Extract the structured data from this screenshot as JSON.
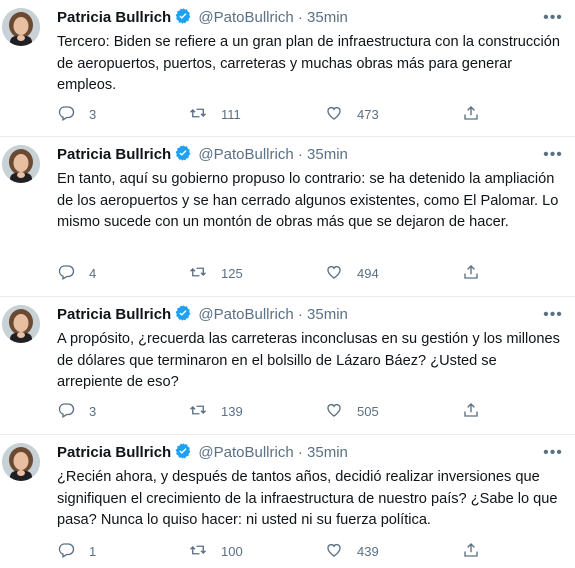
{
  "tweets": [
    {
      "name": "Patricia Bullrich",
      "handle": "@PatoBullrich",
      "separator": "·",
      "time": "35min",
      "text": "Tercero: Biden se refiere a un gran plan de infraestructura con la construcción de aeropuertos, puertos,  carreteras y muchas obras más para generar empleos.",
      "replies": "3",
      "retweets": "111",
      "likes": "473"
    },
    {
      "name": "Patricia Bullrich",
      "handle": "@PatoBullrich",
      "separator": "·",
      "time": "35min",
      "text": "En tanto, aquí su gobierno propuso lo contrario: se ha detenido la ampliación de los aeropuertos y se han cerrado algunos existentes, como El Palomar. Lo mismo sucede con un montón de obras más que se dejaron de hacer.",
      "replies": "4",
      "retweets": "125",
      "likes": "494"
    },
    {
      "name": "Patricia Bullrich",
      "handle": "@PatoBullrich",
      "separator": "·",
      "time": "35min",
      "text": "A propósito,  ¿recuerda las carreteras inconclusas en su gestión y los millones de dólares que terminaron en el bolsillo de Lázaro Báez? ¿Usted se arrepiente de eso?",
      "replies": "3",
      "retweets": "139",
      "likes": "505"
    },
    {
      "name": "Patricia Bullrich",
      "handle": "@PatoBullrich",
      "separator": "·",
      "time": "35min",
      "text": "¿Recién ahora, y después de tantos años, decidió realizar inversiones que signifiquen el crecimiento de la infraestructura de nuestro país? ¿Sabe lo que pasa? Nunca lo quiso hacer: ni usted ni su fuerza política.",
      "replies": "1",
      "retweets": "100",
      "likes": "439"
    }
  ],
  "icons": {
    "verified": "verified-badge-icon",
    "more": "more-options-icon",
    "reply": "reply-icon",
    "retweet": "retweet-icon",
    "like": "like-icon",
    "share": "share-icon"
  },
  "colors": {
    "verified": "#1da1f2",
    "muted": "#5b7083",
    "text": "#0f1419",
    "divider": "#e6ecf0"
  }
}
